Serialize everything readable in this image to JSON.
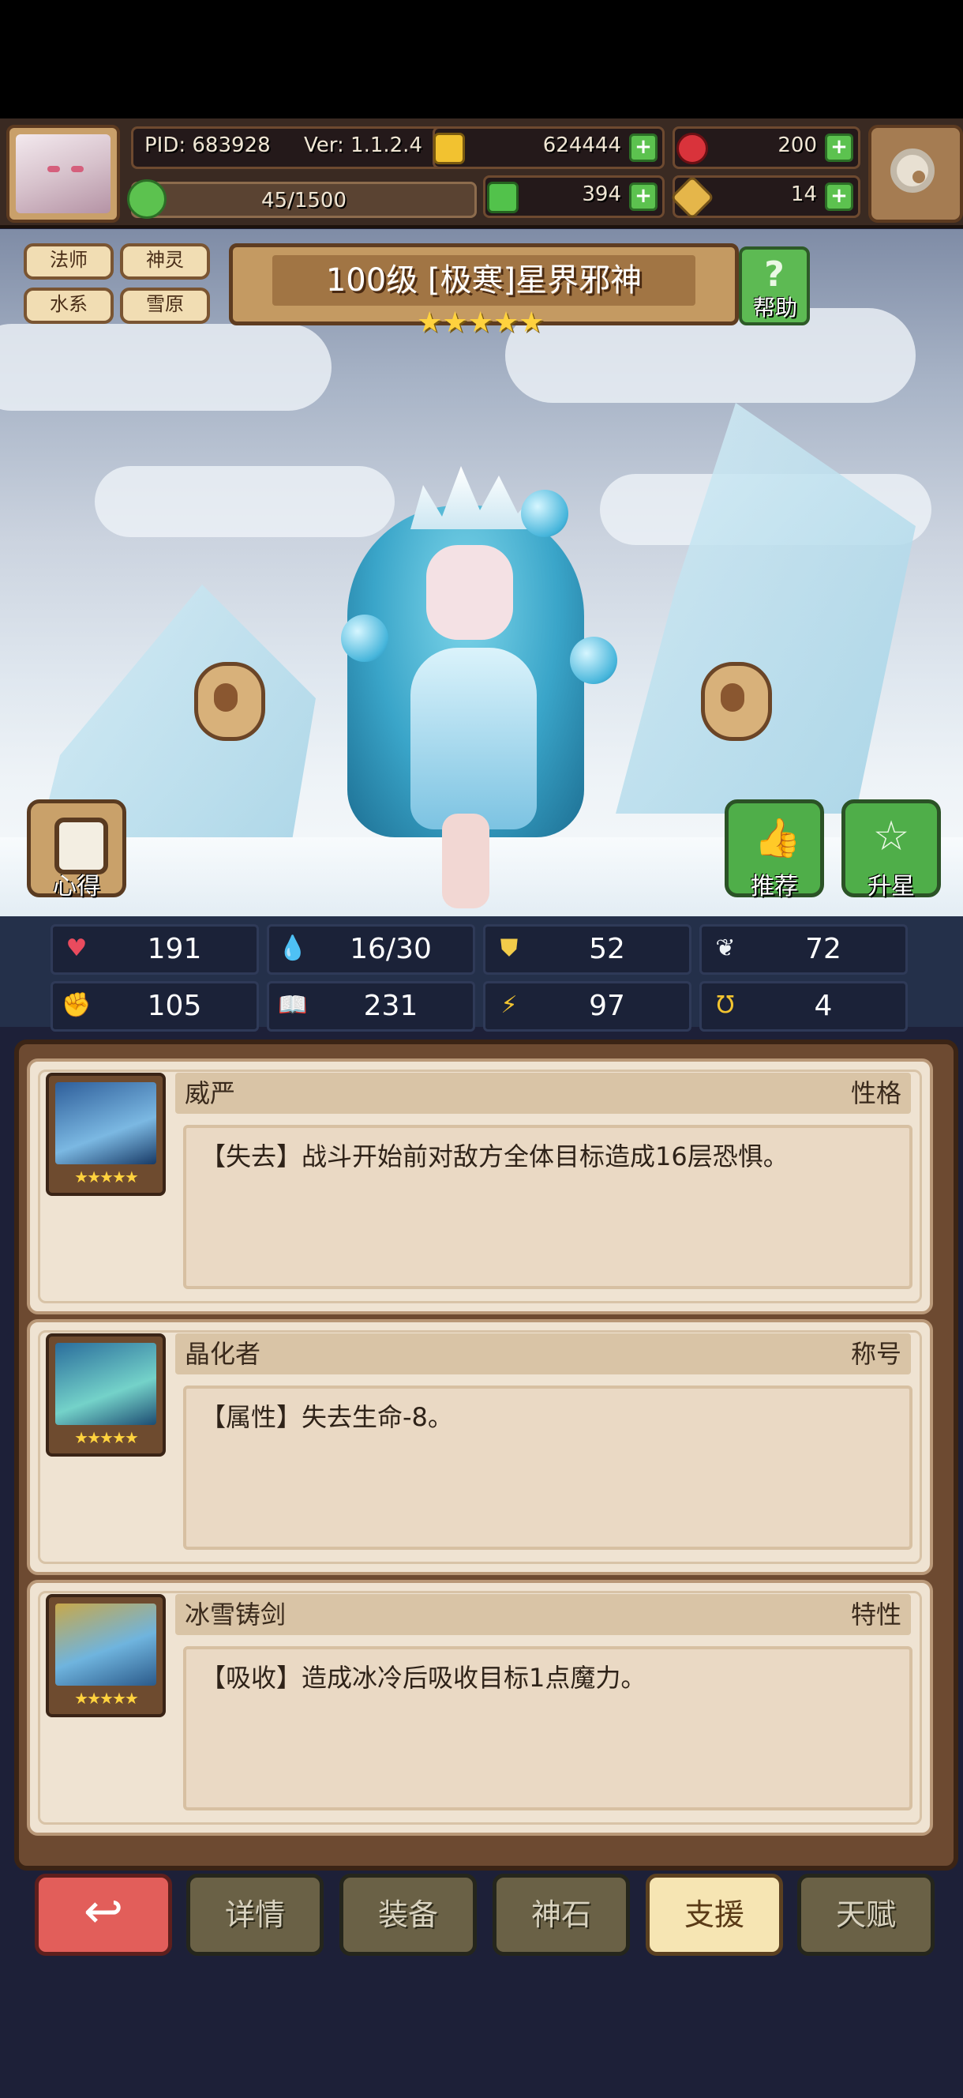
{
  "header": {
    "pid": "PID: 683928",
    "version": "Ver: 1.1.2.4",
    "gold": "624444",
    "gems": "200",
    "stamina": "45/1500",
    "clover": "394",
    "key": "14",
    "colors": {
      "gold": "#f2c230",
      "gem": "#d9333b",
      "clover": "#52c24b",
      "key": "#e5b64a"
    }
  },
  "tags": [
    "法师",
    "神灵",
    "水系",
    "雪原"
  ],
  "hero": {
    "title": "100级 [极寒]星界邪神",
    "stars": "★★★★★",
    "help_label": "帮助"
  },
  "side_buttons": {
    "notes": "心得",
    "recommend": "推荐",
    "star_up": "升星"
  },
  "stats": [
    {
      "icon": "heart-icon",
      "glyph": "♥",
      "color": "#e94b5e",
      "value": "191"
    },
    {
      "icon": "drop-icon",
      "glyph": "💧",
      "color": "#6ec8ef",
      "value": "16/30"
    },
    {
      "icon": "shield-icon",
      "glyph": "⛊",
      "color": "#f2cc4a",
      "value": "52"
    },
    {
      "icon": "feather-icon",
      "glyph": "❦",
      "color": "#eef3f6",
      "value": "72"
    },
    {
      "icon": "fist-icon",
      "glyph": "✊",
      "color": "#e9a37c",
      "value": "105"
    },
    {
      "icon": "book-icon",
      "glyph": "📖",
      "color": "#d9564e",
      "value": "231"
    },
    {
      "icon": "speed-icon",
      "glyph": "⚡",
      "color": "#f2c430",
      "value": "97"
    },
    {
      "icon": "horseshoe-icon",
      "glyph": "Ʊ",
      "color": "#f2c430",
      "value": "4"
    }
  ],
  "skills": [
    {
      "name": "威严",
      "type": "性格",
      "desc": "【失去】战斗开始前对敌方全体目标造成16层恐惧。",
      "stars": "★★★★★"
    },
    {
      "name": "晶化者",
      "type": "称号",
      "desc": "【属性】失去生命-8。",
      "stars": "★★★★★"
    },
    {
      "name": "冰雪铸剑",
      "type": "特性",
      "desc": "【吸收】造成冰冷后吸收目标1点魔力。",
      "stars": "★★★★★"
    }
  ],
  "nav": {
    "back": "↩",
    "details": "详情",
    "equipment": "装备",
    "god_stone": "神石",
    "support": "支援",
    "talent": "天赋"
  }
}
